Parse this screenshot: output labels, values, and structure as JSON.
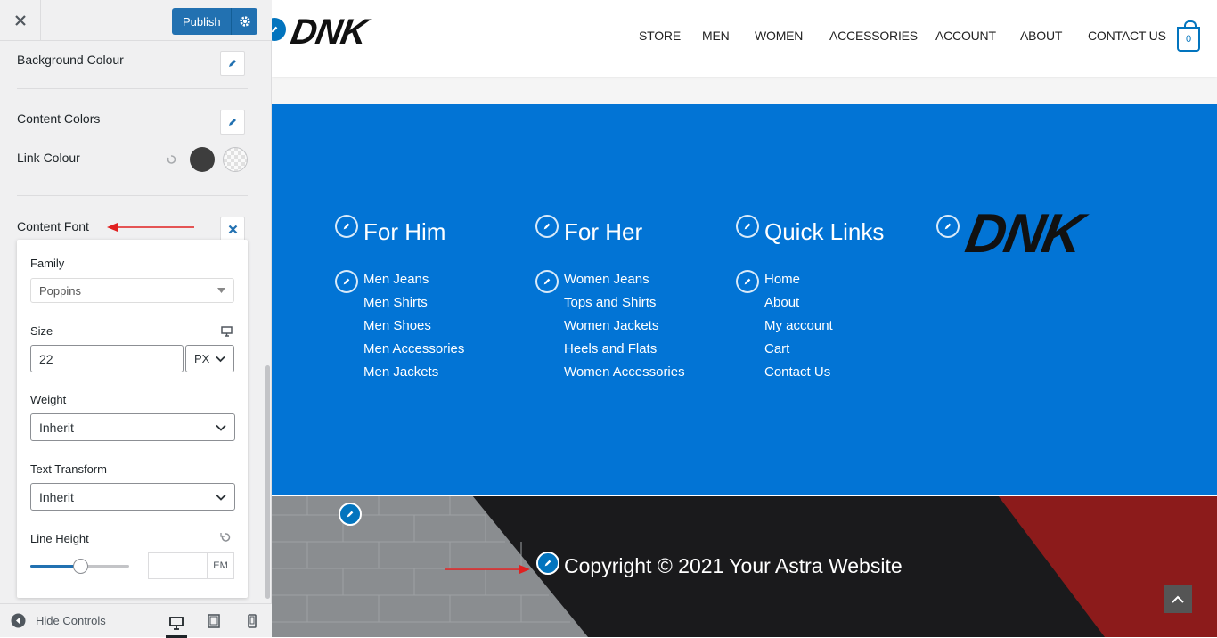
{
  "sidebar": {
    "publish_label": "Publish",
    "background_colour_label": "Background Colour",
    "content_colors_label": "Content Colors",
    "link_colour_label": "Link Colour",
    "content_font_label": "Content Font",
    "font": {
      "family_label": "Family",
      "family_value": "Poppins",
      "size_label": "Size",
      "size_value": "22",
      "size_unit": "PX",
      "weight_label": "Weight",
      "weight_value": "Inherit",
      "transform_label": "Text Transform",
      "transform_value": "Inherit",
      "line_height_label": "Line Height",
      "line_height_unit": "EM",
      "line_height_slider": 0.5
    },
    "hide_controls_label": "Hide Controls"
  },
  "site": {
    "logo": "DNK",
    "nav": [
      "STORE",
      "MEN",
      "WOMEN",
      "ACCESSORIES",
      "ACCOUNT",
      "ABOUT",
      "CONTACT US"
    ],
    "cart_count": "0",
    "footer": {
      "col1_title": "For Him",
      "col1_links": [
        "Men Jeans",
        "Men Shirts",
        "Men Shoes",
        "Men Accessories",
        "Men Jackets"
      ],
      "col2_title": "For Her",
      "col2_links": [
        "Women Jeans",
        "Tops and Shirts",
        "Women Jackets",
        "Heels and Flats",
        "Women Accessories"
      ],
      "col3_title": "Quick Links",
      "col3_links": [
        "Home",
        "About",
        "My account",
        "Cart",
        "Contact Us"
      ],
      "logo": "DNK"
    },
    "copyright": "Copyright © 2021 Your Astra Website"
  },
  "colors": {
    "accent": "#2271b1",
    "footer_blue": "#0274d5",
    "link_colour": "#3d3d3d",
    "arrow": "#e02020"
  }
}
